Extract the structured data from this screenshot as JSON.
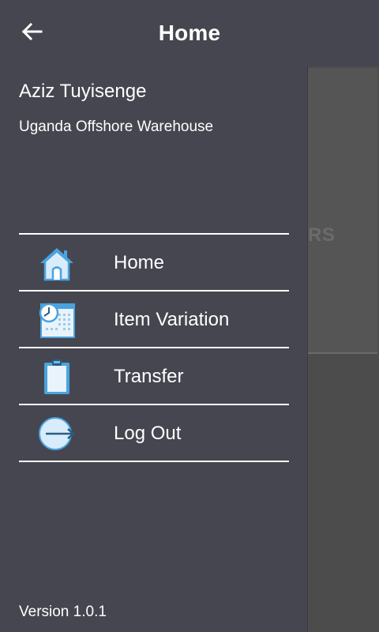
{
  "header": {
    "title": "Home",
    "back_icon": "arrow-left-icon"
  },
  "background": {
    "partial_text": "RS"
  },
  "drawer": {
    "user_name": "Aziz Tuyisenge",
    "warehouse": "Uganda Offshore Warehouse",
    "menu": [
      {
        "label": "Home",
        "icon": "house-icon"
      },
      {
        "label": "Item Variation",
        "icon": "calendar-clock-icon"
      },
      {
        "label": "Transfer",
        "icon": "clipboard-icon"
      },
      {
        "label": "Log Out",
        "icon": "logout-icon"
      }
    ],
    "version": "Version 1.0.1"
  },
  "colors": {
    "bar": "#45464f",
    "icon_blue": "#4aa3df",
    "icon_light": "#d9ecfb",
    "overlay_bg": "#4c4c4c"
  }
}
